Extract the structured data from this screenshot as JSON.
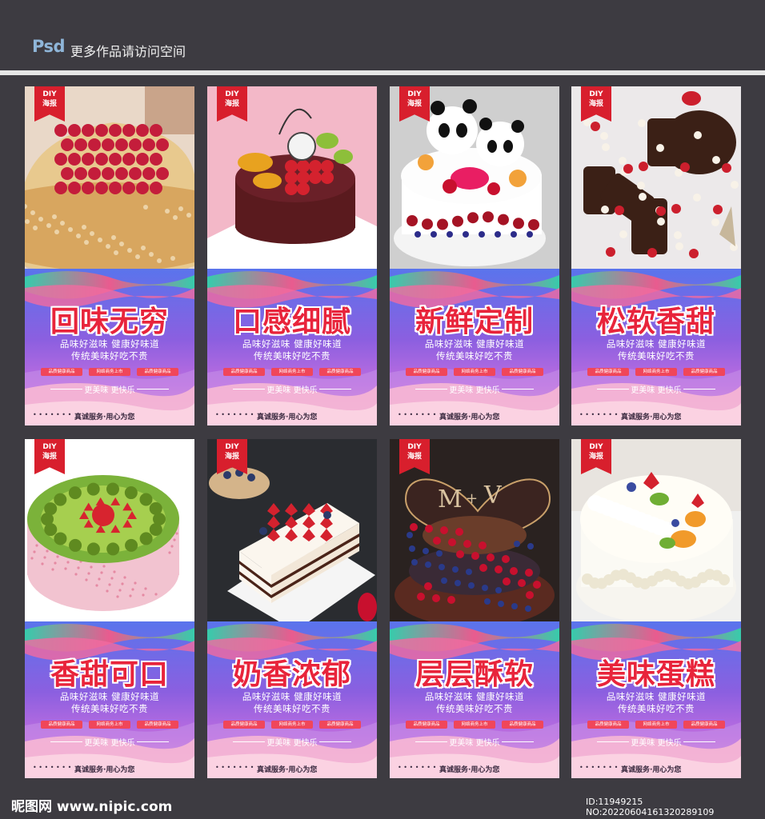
{
  "header": {
    "psd_label": "Psd",
    "text": "更多作品请访问空间"
  },
  "badge": {
    "line1": "DIY",
    "line2": "海报"
  },
  "common": {
    "sub1": "品味好滋味  健康好味道",
    "sub2": "传统美味好吃不贵",
    "tags": [
      "品质健康商品",
      "网络商务上市",
      "品质健康商品"
    ],
    "slogan": "更美味 更快乐",
    "footer": "真诚服务·用心为您",
    "footer_dots": "• • • • • • •"
  },
  "cards": [
    {
      "title": "回味无穷",
      "scene": "raspberry"
    },
    {
      "title": "口感细腻",
      "scene": "fruit-pink"
    },
    {
      "title": "新鲜定制",
      "scene": "panda"
    },
    {
      "title": "松软香甜",
      "scene": "letters"
    },
    {
      "title": "香甜可口",
      "scene": "kiwi"
    },
    {
      "title": "奶香浓郁",
      "scene": "naked"
    },
    {
      "title": "层层酥软",
      "scene": "heart"
    },
    {
      "title": "美味蛋糕",
      "scene": "cream"
    }
  ],
  "watermark": {
    "logo": "昵图网 www.nipic.com",
    "id": "ID:11949215 NO:20220604161320289109"
  },
  "colors": {
    "background": "#3d3b41",
    "title_red": "#e8243b",
    "badge_red": "#d81f2d"
  }
}
